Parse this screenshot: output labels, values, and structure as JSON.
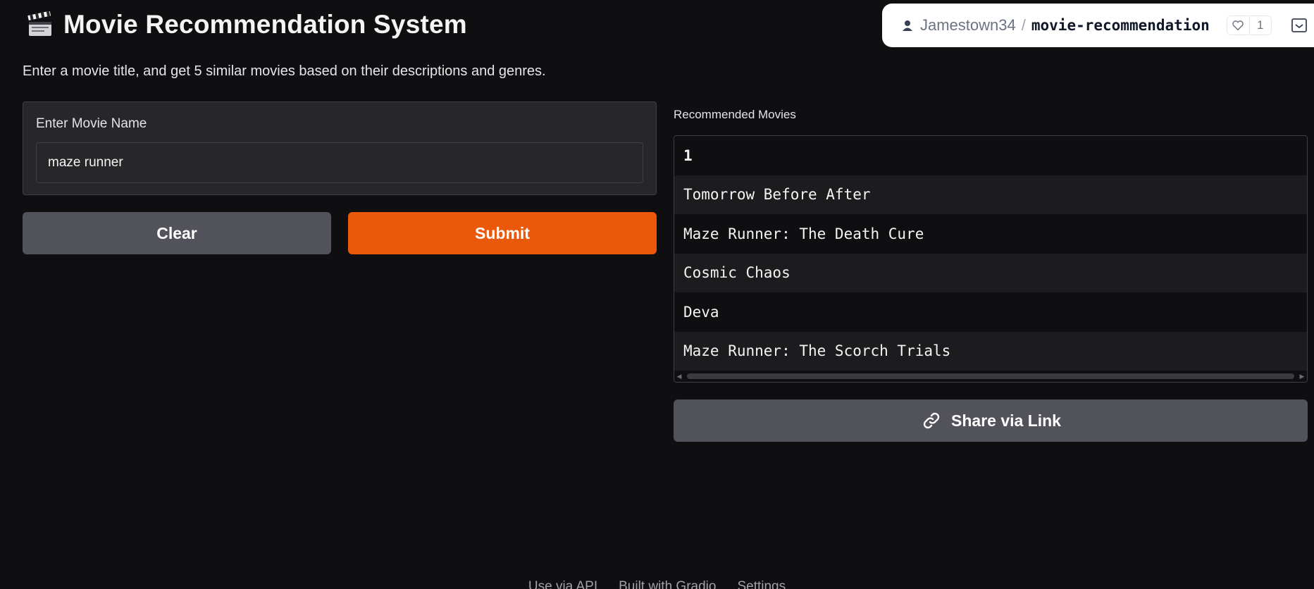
{
  "header": {
    "title": "Movie Recommendation System",
    "description": "Enter a movie title, and get 5 similar movies based on their descriptions and genres.",
    "icon": "clapperboard-icon"
  },
  "space_badge": {
    "user": "Jamestown34",
    "separator": "/",
    "repo": "movie-recommendation",
    "likes": "1"
  },
  "input": {
    "label": "Enter Movie Name",
    "value": "maze runner"
  },
  "buttons": {
    "clear": "Clear",
    "submit": "Submit",
    "share": "Share via Link"
  },
  "output": {
    "label": "Recommended Movies",
    "header": "1",
    "rows": [
      "Tomorrow Before After",
      "Maze Runner: The Death Cure",
      "Cosmic Chaos",
      "Deva",
      "Maze Runner: The Scorch Trials"
    ]
  },
  "footer": {
    "api": "Use via API",
    "built": "Built with Gradio",
    "settings": "Settings"
  },
  "colors": {
    "accent": "#ea580c",
    "secondary_button": "#52525b",
    "background": "#0f0f11"
  }
}
